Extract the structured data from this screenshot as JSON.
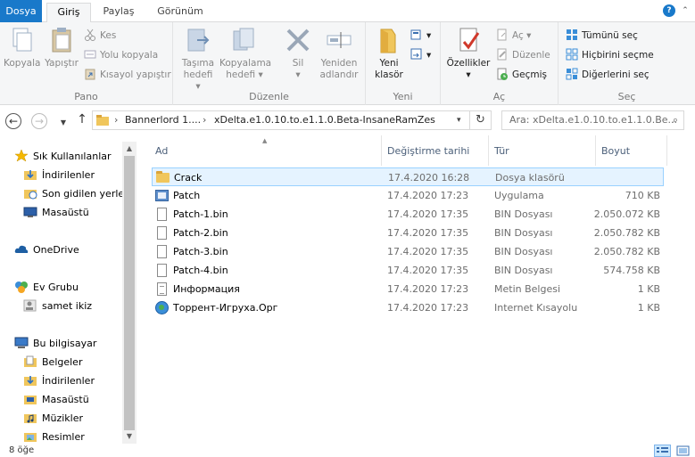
{
  "tabs": {
    "file": "Dosya",
    "home": "Giriş",
    "share": "Paylaş",
    "view": "Görünüm"
  },
  "ribbon": {
    "clipboard": {
      "label": "Pano",
      "copy": "Kopyala",
      "paste": "Yapıştır",
      "cut": "Kes",
      "copy_path": "Yolu kopyala",
      "paste_shortcut": "Kısayol yapıştır"
    },
    "organize": {
      "label": "Düzenle",
      "move_to": [
        "Taşıma",
        "hedefi"
      ],
      "copy_to": [
        "Kopyalama",
        "hedefi"
      ],
      "delete": "Sil",
      "rename": [
        "Yeniden",
        "adlandır"
      ]
    },
    "new": {
      "label": "Yeni",
      "new_folder": [
        "Yeni",
        "klasör"
      ]
    },
    "open": {
      "label": "Aç",
      "properties": "Özellikler",
      "open": "Aç",
      "edit": "Düzenle",
      "history": "Geçmiş"
    },
    "select": {
      "label": "Seç",
      "select_all": "Tümünü seç",
      "select_none": "Hiçbirini seçme",
      "invert": "Diğerlerini seç"
    }
  },
  "address": {
    "crumbs": [
      "Bannerlord 1....",
      "xDelta.e1.0.10.to.e1.1.0.Beta-InsaneRamZes"
    ],
    "search_placeholder": "Ara: xDelta.e1.0.10.to.e1.1.0.Be..."
  },
  "navpane": [
    {
      "label": "Sık Kullanılanlar",
      "icon": "star-icon"
    },
    {
      "label": "İndirilenler",
      "icon": "downloads-icon"
    },
    {
      "label": "Son gidilen yerler",
      "icon": "recent-places-icon"
    },
    {
      "label": "Masaüstü",
      "icon": "desktop-icon"
    },
    {
      "label": "OneDrive",
      "icon": "cloud-icon"
    },
    {
      "label": "Ev Grubu",
      "icon": "homegroup-icon"
    },
    {
      "label": "samet ikiz",
      "icon": "user-icon"
    },
    {
      "label": "Bu bilgisayar",
      "icon": "computer-icon"
    },
    {
      "label": "Belgeler",
      "icon": "documents-icon"
    },
    {
      "label": "İndirilenler",
      "icon": "downloads-icon"
    },
    {
      "label": "Masaüstü",
      "icon": "desktop-icon"
    },
    {
      "label": "Müzikler",
      "icon": "music-icon"
    },
    {
      "label": "Resimler",
      "icon": "pictures-icon"
    }
  ],
  "columns": {
    "name": "Ad",
    "date": "Değiştirme tarihi",
    "type": "Tür",
    "size": "Boyut"
  },
  "files": [
    {
      "name": "Crack",
      "date": "17.4.2020 16:28",
      "type": "Dosya klasörü",
      "size": "",
      "icon": "folder-icon"
    },
    {
      "name": "Patch",
      "date": "17.4.2020 17:23",
      "type": "Uygulama",
      "size": "710 KB",
      "icon": "application-icon"
    },
    {
      "name": "Patch-1.bin",
      "date": "17.4.2020 17:35",
      "type": "BIN Dosyası",
      "size": "2.050.072 KB",
      "icon": "file-icon"
    },
    {
      "name": "Patch-2.bin",
      "date": "17.4.2020 17:35",
      "type": "BIN Dosyası",
      "size": "2.050.782 KB",
      "icon": "file-icon"
    },
    {
      "name": "Patch-3.bin",
      "date": "17.4.2020 17:35",
      "type": "BIN Dosyası",
      "size": "2.050.782 KB",
      "icon": "file-icon"
    },
    {
      "name": "Patch-4.bin",
      "date": "17.4.2020 17:35",
      "type": "BIN Dosyası",
      "size": "574.758 KB",
      "icon": "file-icon"
    },
    {
      "name": "Информация",
      "date": "17.4.2020 17:23",
      "type": "Metin Belgesi",
      "size": "1 KB",
      "icon": "text-file-icon"
    },
    {
      "name": "Торрент-Игруха.Орг",
      "date": "17.4.2020 17:23",
      "type": "Internet Kısayolu",
      "size": "1 KB",
      "icon": "internet-shortcut-icon"
    }
  ],
  "status": {
    "item_count": "8 öğe"
  },
  "colors": {
    "accent": "#1979ca",
    "selection": "#e5f3ff",
    "selection_border": "#99d1ff",
    "header_text": "#4c607a"
  }
}
